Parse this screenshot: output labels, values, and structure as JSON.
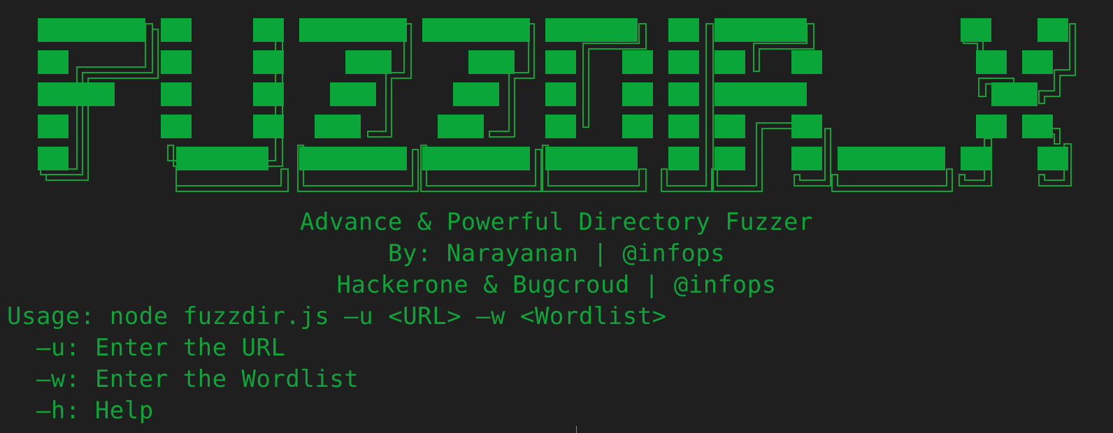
{
  "terminal": {
    "accent_color": "#0fa33a",
    "background_color": "#1f1f1f"
  },
  "banner": {
    "logo_text": "FUZZDIR_X"
  },
  "header_lines": [
    "Advance & Powerful Directory Fuzzer",
    "By: Narayanan | @infops",
    "Hackerone & Bugcroud | @infops"
  ],
  "usage": {
    "command": "Usage: node fuzzdir.js –u <URL> –w <Wordlist>",
    "options": [
      "  –u: Enter the URL",
      "  –w: Enter the Wordlist",
      "  –h: Help"
    ]
  }
}
